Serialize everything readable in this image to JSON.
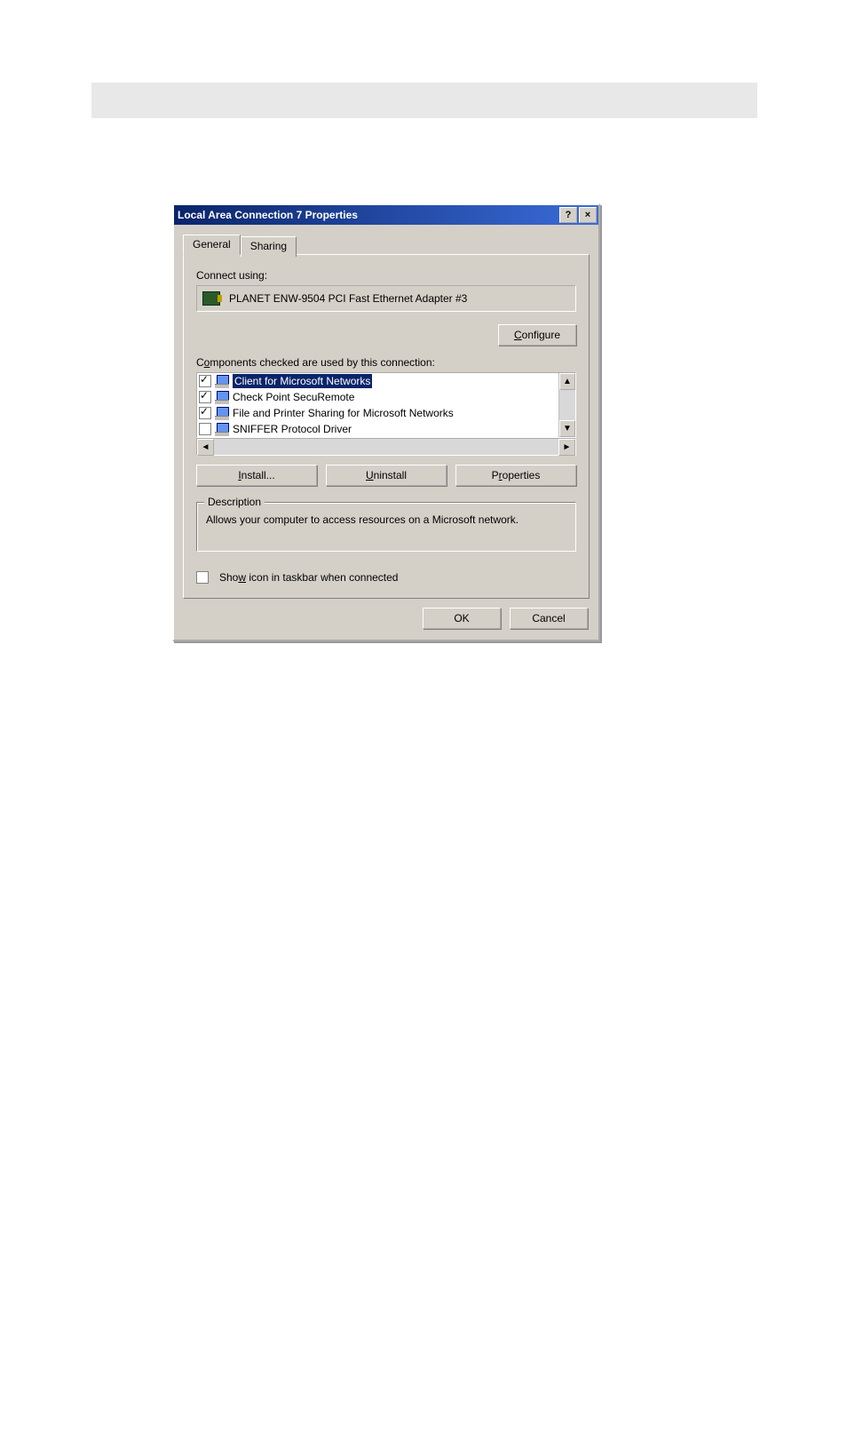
{
  "dialog": {
    "title": "Local Area Connection 7 Properties",
    "help_btn": "?",
    "close_btn": "×"
  },
  "tabs": {
    "general": "General",
    "sharing": "Sharing"
  },
  "connect_using_label": "Connect using:",
  "adapter": "PLANET ENW-9504 PCI Fast Ethernet Adapter #3",
  "configure_btn": {
    "pre": "",
    "u": "C",
    "post": "onfigure"
  },
  "components_label": {
    "pre": "C",
    "u": "o",
    "post": "mponents checked are used by this connection:"
  },
  "components": [
    {
      "checked": true,
      "label": "Client for Microsoft Networks",
      "selected": true
    },
    {
      "checked": true,
      "label": "Check Point SecuRemote",
      "selected": false
    },
    {
      "checked": true,
      "label": "File and Printer Sharing for Microsoft Networks",
      "selected": false
    },
    {
      "checked": false,
      "label": "SNIFFER Protocol Driver",
      "selected": false
    }
  ],
  "install_btn": {
    "u": "I",
    "post": "nstall..."
  },
  "uninstall_btn": {
    "u": "U",
    "post": "ninstall"
  },
  "properties_btn": {
    "pre": "P",
    "u": "r",
    "post": "operties"
  },
  "description": {
    "legend": "Description",
    "text": "Allows your computer to access resources on a Microsoft network."
  },
  "show_icon": {
    "pre": "Sho",
    "u": "w",
    "post": " icon in taskbar when connected",
    "checked": false
  },
  "ok_btn": "OK",
  "cancel_btn": "Cancel"
}
